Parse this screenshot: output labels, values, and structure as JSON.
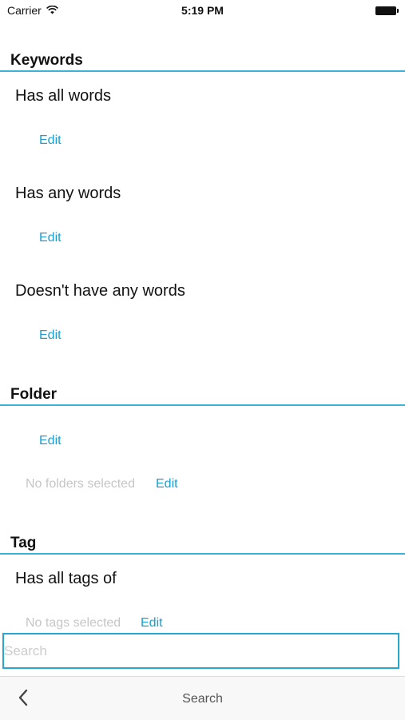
{
  "status_bar": {
    "carrier": "Carrier",
    "time": "5:19 PM",
    "wifi_icon": "wifi-icon",
    "battery_icon": "battery-icon"
  },
  "keywords": {
    "header": "Keywords",
    "has_all_words": {
      "label": "Has all words",
      "edit": "Edit"
    },
    "has_any_words": {
      "label": "Has any words",
      "edit": "Edit"
    },
    "doesnt_have_words": {
      "label": "Doesn't have any words",
      "edit": "Edit"
    }
  },
  "folder": {
    "header": "Folder",
    "edit": "Edit",
    "empty_text": "No folders selected",
    "empty_edit": "Edit"
  },
  "tag": {
    "header": "Tag",
    "has_all_tags": {
      "label": "Has all tags of"
    },
    "empty_text": "No tags selected",
    "empty_edit": "Edit"
  },
  "search": {
    "placeholder": "Search",
    "value": ""
  },
  "bottom_bar": {
    "title": "Search",
    "back_icon": "chevron-left-icon"
  },
  "colors": {
    "accent": "#1a9fcf",
    "divider": "#3bb3d9",
    "placeholder": "#c6c6c6"
  }
}
